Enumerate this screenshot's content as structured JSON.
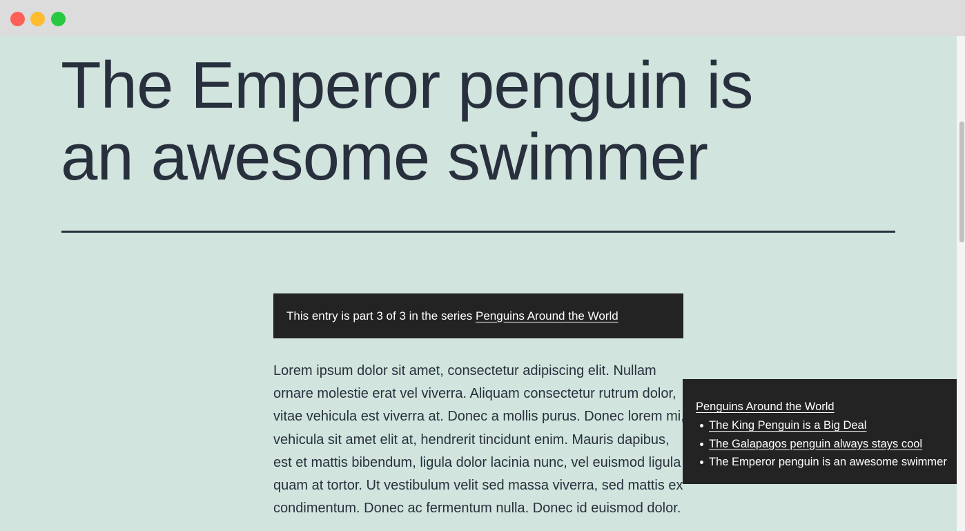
{
  "window": {
    "controls": [
      "close",
      "minimize",
      "zoom"
    ]
  },
  "post": {
    "title": "The Emperor penguin is an awesome swimmer",
    "series_notice": {
      "prefix": "This entry is part 3 of 3 in the series ",
      "series_link": "Penguins Around the World"
    },
    "body": "Lorem ipsum dolor sit amet, consectetur adipiscing elit. Nullam ornare molestie erat vel viverra. Aliquam consectetur rutrum dolor, vitae vehicula est viverra at. Donec a mollis purus. Donec lorem mi, vehicula sit amet elit at, hendrerit tincidunt enim. Mauris dapibus, est et mattis bibendum, ligula dolor lacinia nunc, vel euismod ligula quam at tortor. Ut vestibulum velit sed massa viverra, sed mattis ex condimentum. Donec ac fermentum nulla. Donec id euismod dolor."
  },
  "series_toc": {
    "title": "Penguins Around the World",
    "items": [
      {
        "label": "The King Penguin is a Big Deal",
        "is_link": true
      },
      {
        "label": "The Galapagos penguin always stays cool",
        "is_link": true
      },
      {
        "label": "The Emperor penguin is an awesome swimmer",
        "is_link": false
      }
    ]
  },
  "colors": {
    "page_background": "#d1e4dd",
    "text": "#28303d",
    "box_background": "#232323",
    "box_text": "#ffffff"
  }
}
